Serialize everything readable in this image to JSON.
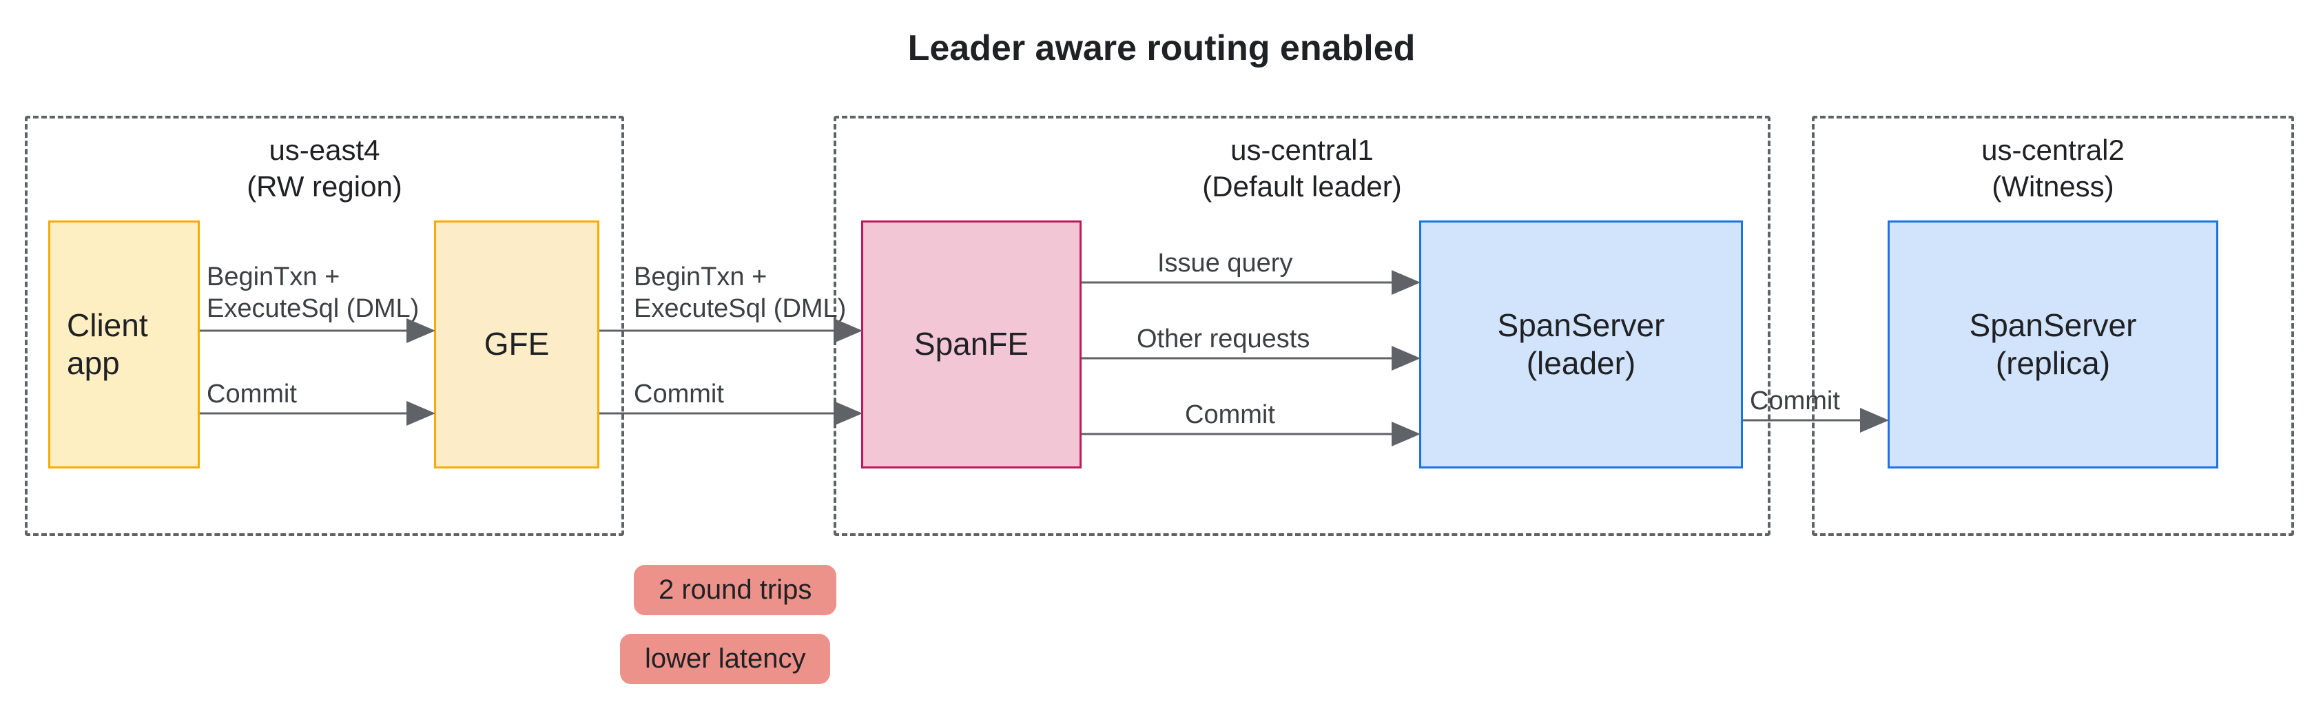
{
  "title": "Leader aware routing enabled",
  "regions": {
    "east": {
      "name": "us-east4",
      "role": "(RW region)"
    },
    "central1": {
      "name": "us-central1",
      "role": "(Default leader)"
    },
    "central2": {
      "name": "us-central2",
      "role": "(Witness)"
    }
  },
  "nodes": {
    "client": "Client\napp",
    "gfe": "GFE",
    "spanfe": "SpanFE",
    "leader": "SpanServer\n(leader)",
    "replica": "SpanServer\n(replica)"
  },
  "edges": {
    "client_gfe_top": "BeginTxn +\nExecuteSql (DML)",
    "client_gfe_bot": "Commit",
    "gfe_spanfe_top": "BeginTxn +\nExecuteSql (DML)",
    "gfe_spanfe_bot": "Commit",
    "spanfe_leader_1": "Issue query",
    "spanfe_leader_2": "Other requests",
    "spanfe_leader_3": "Commit",
    "leader_replica": "Commit"
  },
  "pills": {
    "roundtrips": "2 round trips",
    "latency": "lower latency"
  }
}
